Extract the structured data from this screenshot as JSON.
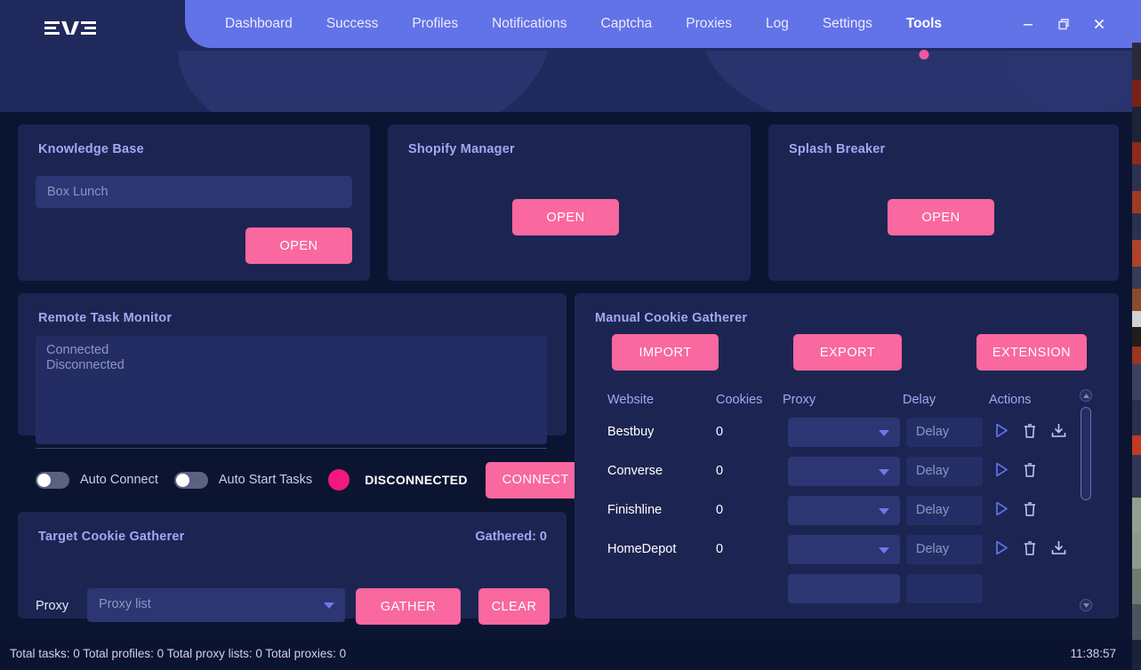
{
  "app": {
    "logo_text": "EVE"
  },
  "nav": {
    "items": [
      {
        "label": "Dashboard",
        "active": false
      },
      {
        "label": "Success",
        "active": false
      },
      {
        "label": "Profiles",
        "active": false
      },
      {
        "label": "Notifications",
        "active": false
      },
      {
        "label": "Captcha",
        "active": false
      },
      {
        "label": "Proxies",
        "active": false
      },
      {
        "label": "Log",
        "active": false
      },
      {
        "label": "Settings",
        "active": false
      },
      {
        "label": "Tools",
        "active": true
      }
    ],
    "accent_color": "#f0579e",
    "band_color": "#6273e8"
  },
  "window_controls": {
    "minimize": "minimize-icon",
    "restore": "restore-icon",
    "close": "close-icon"
  },
  "knowledge_base": {
    "title": "Knowledge Base",
    "input_placeholder": "Box Lunch",
    "input_value": "",
    "open_label": "OPEN"
  },
  "shopify_manager": {
    "title": "Shopify Manager",
    "open_label": "OPEN"
  },
  "splash_breaker": {
    "title": "Splash Breaker",
    "open_label": "OPEN"
  },
  "remote_task_monitor": {
    "title": "Remote Task Monitor",
    "log_lines": "Connected\nDisconnected",
    "auto_connect_label": "Auto Connect",
    "auto_connect_on": false,
    "auto_start_label": "Auto Start Tasks",
    "auto_start_on": false,
    "status_text": "DISCONNECTED",
    "status_color": "#f5187c",
    "connect_label": "CONNECT"
  },
  "target_cookie_gatherer": {
    "title": "Target Cookie Gatherer",
    "gathered_label": "Gathered: 0",
    "proxy_label": "Proxy",
    "proxy_placeholder": "Proxy list",
    "gather_label": "GATHER",
    "clear_label": "CLEAR"
  },
  "manual_cookie_gatherer": {
    "title": "Manual Cookie Gatherer",
    "import_label": "IMPORT",
    "export_label": "EXPORT",
    "extension_label": "EXTENSION",
    "columns": [
      "Website",
      "Cookies",
      "Proxy",
      "Delay",
      "Actions"
    ],
    "delay_placeholder": "Delay",
    "rows": [
      {
        "website": "Bestbuy",
        "cookies": "0",
        "proxy": "",
        "delay": "",
        "actions": [
          "play-icon",
          "trash-icon",
          "download-icon"
        ]
      },
      {
        "website": "Converse",
        "cookies": "0",
        "proxy": "",
        "delay": "",
        "actions": [
          "play-icon",
          "trash-icon"
        ]
      },
      {
        "website": "Finishline",
        "cookies": "0",
        "proxy": "",
        "delay": "",
        "actions": [
          "play-icon",
          "trash-icon"
        ]
      },
      {
        "website": "HomeDepot",
        "cookies": "0",
        "proxy": "",
        "delay": "",
        "actions": [
          "play-icon",
          "trash-icon",
          "download-icon"
        ]
      },
      {
        "website": "",
        "cookies": "",
        "proxy": "",
        "delay": "",
        "actions": []
      }
    ]
  },
  "status_bar": {
    "summary": "Total tasks: 0  Total profiles: 0  Total proxy lists: 0  Total proxies: 0",
    "time": "11:38:57"
  },
  "theme": {
    "page_bg": "#0b1531",
    "panel_bg": "#1c2552",
    "header_bg": "#20295c",
    "pink": "#f9689f",
    "title_color": "#9fa9f2"
  }
}
